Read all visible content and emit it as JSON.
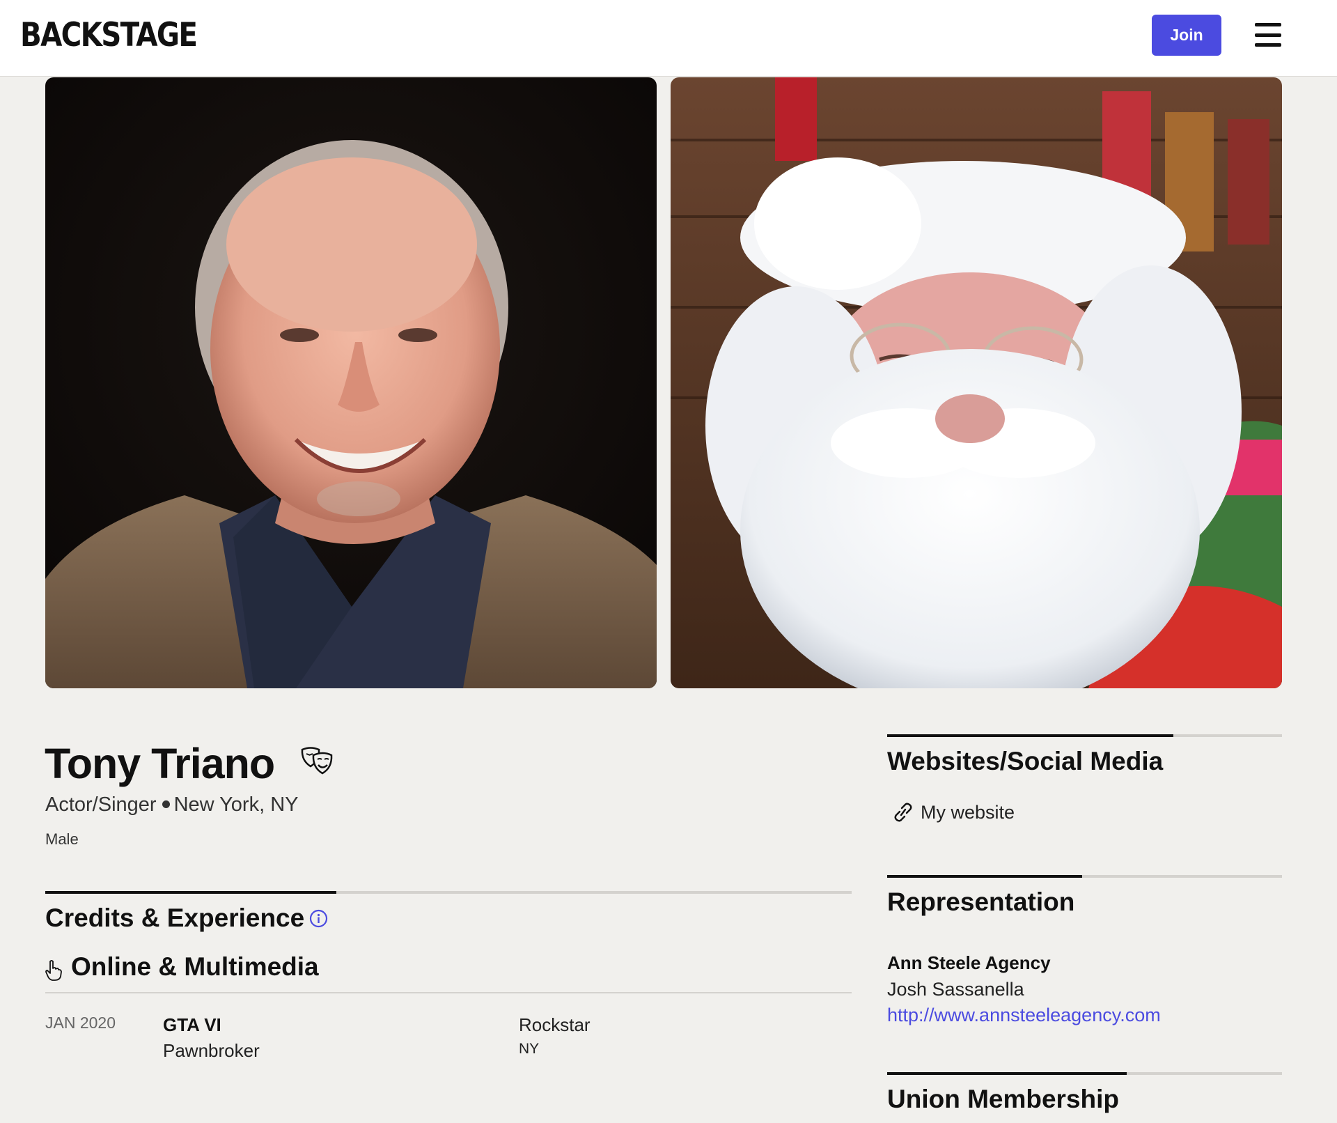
{
  "header": {
    "logo": "BACKSTAGE",
    "join_label": "Join"
  },
  "photos": [
    {
      "name": "headshot-photo"
    },
    {
      "name": "santa-photo"
    }
  ],
  "profile": {
    "name": "Tony Triano",
    "role": "Actor/Singer",
    "location": "New York, NY",
    "gender": "Male"
  },
  "credits": {
    "title": "Credits & Experience",
    "category": "Online & Multimedia",
    "items": [
      {
        "date": "JAN 2020",
        "title": "GTA VI",
        "role": "Pawnbroker",
        "company": "Rockstar",
        "location": "NY"
      }
    ]
  },
  "websites": {
    "title": "Websites/Social Media",
    "link_label": "My website"
  },
  "representation": {
    "title": "Representation",
    "agency": "Ann Steele Agency",
    "agent": "Josh Sassanella",
    "url": "http://www.annsteeleagency.com"
  },
  "union": {
    "title": "Union Membership"
  },
  "colors": {
    "accent": "#4b4be0",
    "background": "#f1f0ed"
  }
}
